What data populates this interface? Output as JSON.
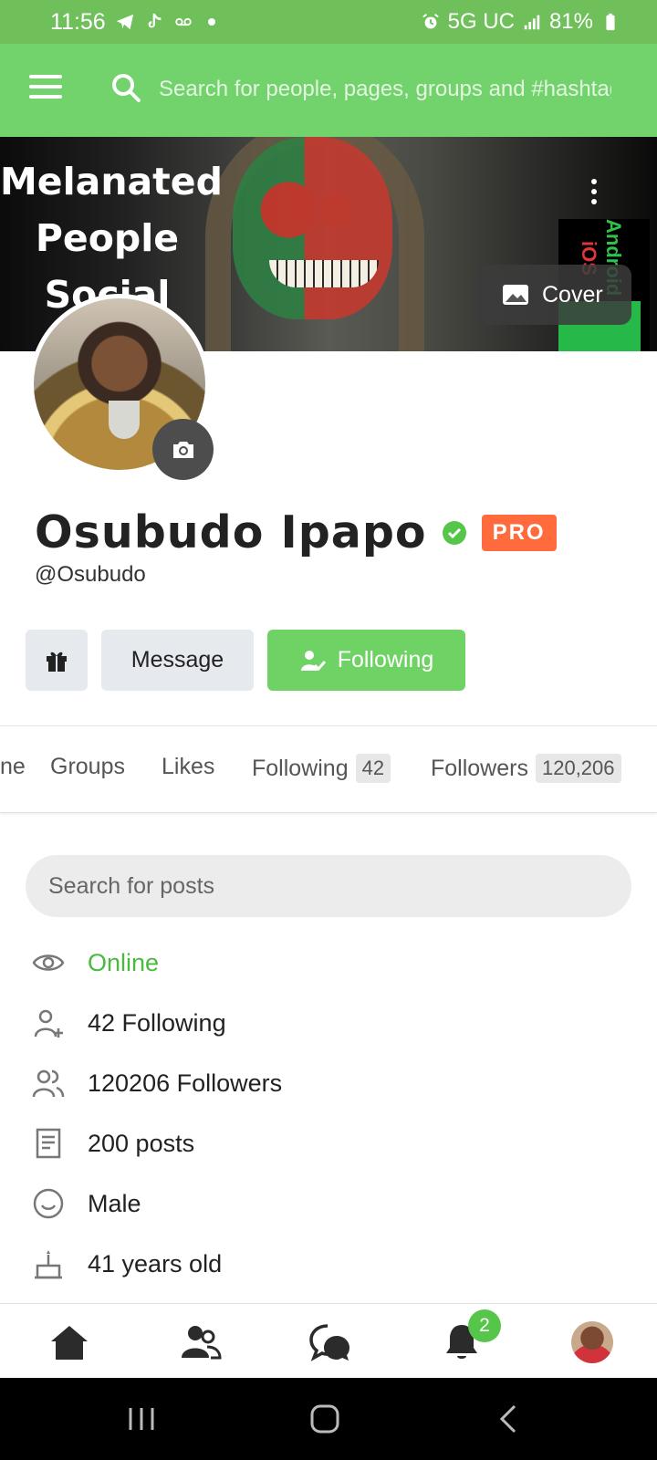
{
  "status_bar": {
    "time": "11:56",
    "network": "5G UC",
    "battery": "81%"
  },
  "header": {
    "search_placeholder": "Search for people, pages, groups and #hashtags"
  },
  "cover": {
    "title_lines": [
      "Melanated",
      "People",
      "Social"
    ],
    "side_text_green": "Android",
    "side_text_red": "iOS",
    "cover_button_label": "Cover"
  },
  "profile": {
    "name": "Osubudo Ipapo",
    "badge": "PRO",
    "username": "@Osubudo"
  },
  "actions": {
    "message_label": "Message",
    "following_label": "Following"
  },
  "tabs": [
    {
      "label": "ne"
    },
    {
      "label": "Groups"
    },
    {
      "label": "Likes"
    },
    {
      "label": "Following",
      "count": "42"
    },
    {
      "label": "Followers",
      "count": "120,206"
    }
  ],
  "post_search": {
    "placeholder": "Search for posts"
  },
  "info": {
    "online": "Online",
    "following": "42 Following",
    "followers": "120206 Followers",
    "posts": "200 posts",
    "gender": "Male",
    "age": "41 years old"
  },
  "bottom_nav": {
    "notification_count": "2"
  },
  "colors": {
    "brand_green": "#72d26b",
    "status_green": "#6fbf5a",
    "pro_orange": "#ff6b3d",
    "online_green": "#4aba3f"
  }
}
